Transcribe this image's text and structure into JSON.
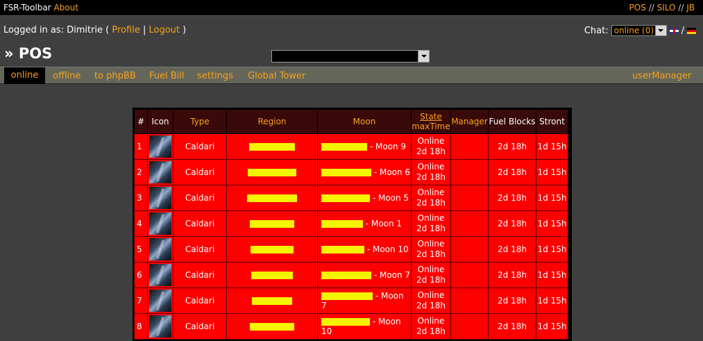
{
  "topbar": {
    "app_name": "FSR-Toolbar",
    "about_label": "About",
    "links": [
      "POS",
      "SILO",
      "JB"
    ],
    "separator": "//"
  },
  "user": {
    "prefix": "Logged in as: Dimitrie (",
    "profile_label": "Profile",
    "divider": "|",
    "logout_label": "Logout",
    "suffix": ")"
  },
  "chat": {
    "label": "Chat:",
    "selected": "online (0)",
    "lang_divider": "/"
  },
  "page": {
    "title": "» POS"
  },
  "tabs": {
    "online": "online",
    "offline": "offline",
    "phpbb": "to phpBB",
    "fuel_bill": "Fuel Bill",
    "settings": "settings",
    "global_tower": "Global Tower",
    "user_manager": "userManager"
  },
  "table": {
    "headers": {
      "num": "#",
      "icon": "Icon",
      "type": "Type",
      "region": "Region",
      "moon": "Moon",
      "state": "State",
      "max_time": "maxTime",
      "manager": "Manager",
      "fuel_blocks": "Fuel Blocks",
      "stront": "Stront"
    },
    "rows": [
      {
        "num": "1",
        "type": "Caldari",
        "moon": "- Moon 9",
        "state": "Online",
        "state_time": "2d 18h",
        "fuel": "2d 18h",
        "stront": "1d 15h"
      },
      {
        "num": "2",
        "type": "Caldari",
        "moon": "- Moon 6",
        "state": "Online",
        "state_time": "2d 18h",
        "fuel": "2d 18h",
        "stront": "1d 15h"
      },
      {
        "num": "3",
        "type": "Caldari",
        "moon": "- Moon 5",
        "state": "Online",
        "state_time": "2d 18h",
        "fuel": "2d 18h",
        "stront": "1d 15h"
      },
      {
        "num": "4",
        "type": "Caldari",
        "moon": "- Moon 1",
        "state": "Online",
        "state_time": "2d 18h",
        "fuel": "2d 18h",
        "stront": "1d 15h"
      },
      {
        "num": "5",
        "type": "Caldari",
        "moon": "- Moon 10",
        "state": "Online",
        "state_time": "2d 18h",
        "fuel": "2d 18h",
        "stront": "1d 15h"
      },
      {
        "num": "6",
        "type": "Caldari",
        "moon": "- Moon 7",
        "state": "Online",
        "state_time": "2d 18h",
        "fuel": "2d 18h",
        "stront": "1d 15h"
      },
      {
        "num": "7",
        "type": "Caldari",
        "moon": "- Moon 7",
        "state": "Online",
        "state_time": "2d 18h",
        "fuel": "2d 18h",
        "stront": "1d 15h"
      },
      {
        "num": "8",
        "type": "Caldari",
        "moon": "- Moon 10",
        "state": "Online",
        "state_time": "2d 18h",
        "fuel": "2d 18h",
        "stront": "1d 15h"
      }
    ]
  },
  "colors": {
    "accent": "#f7a21b",
    "row_background": "#ff0000",
    "header_background": "#3a0a0a",
    "redaction": "#f5f500"
  }
}
